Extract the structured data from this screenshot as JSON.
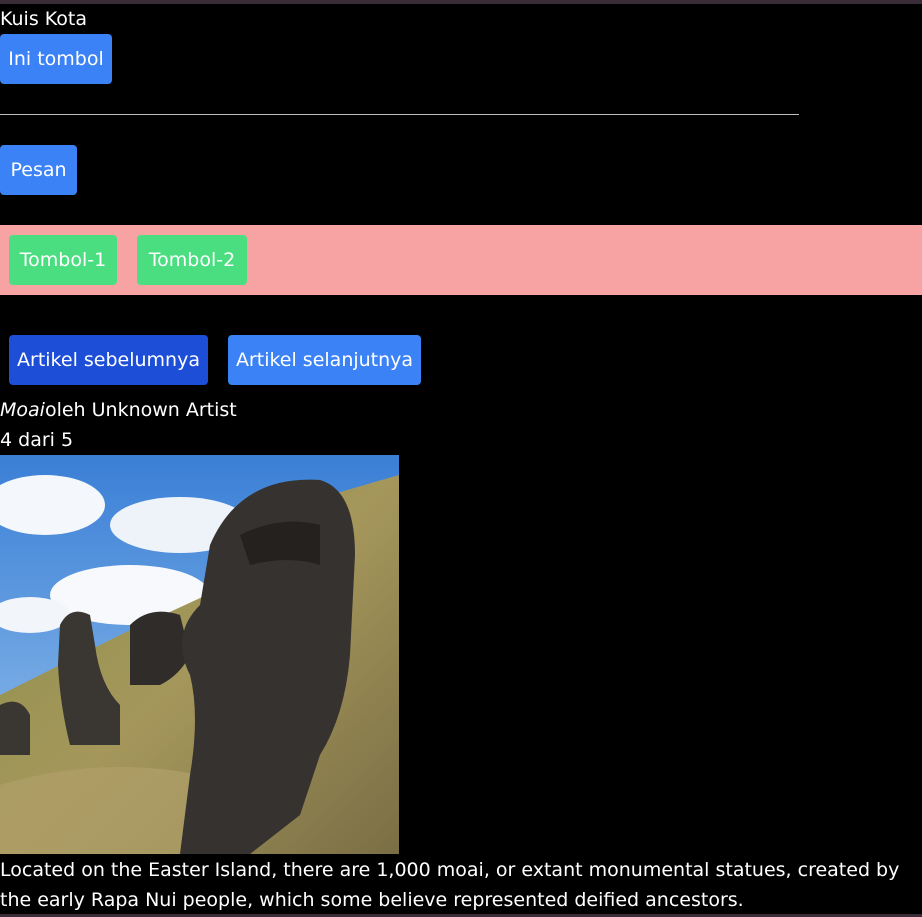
{
  "page": {
    "heading": "Kuis Kota"
  },
  "buttons": {
    "ini_tombol": "Ini tombol",
    "pesan": "Pesan",
    "tombol1": "Tombol-1",
    "tombol2": "Tombol-2",
    "prev_article": "Artikel sebelumnya",
    "next_article": "Artikel selanjutnya"
  },
  "gallery": {
    "title": "Moai",
    "artist": "oleh Unknown Artist",
    "counter": "4 dari 5",
    "description": "Located on the Easter Island, there are 1,000 moai, or extant monumental statues, created by the early Rapa Nui people, which some believe represented deified ancestors."
  },
  "colors": {
    "background": "#000000",
    "button_blue": "#3b82f6",
    "button_dark_blue": "#1d4ed8",
    "button_green": "#4ade80",
    "toolbar_pink": "#f8a3a3"
  },
  "icons": {
    "photo": "moai-statue-image"
  }
}
